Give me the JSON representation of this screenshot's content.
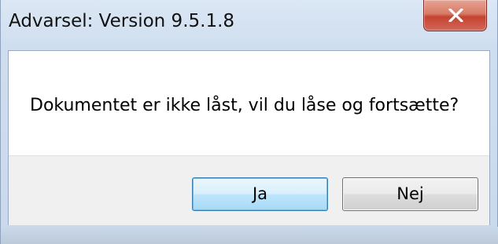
{
  "window": {
    "title": "Advarsel: Version 9.5.1.8",
    "close_icon": "close-icon"
  },
  "dialog": {
    "message": "Dokumentet er ikke låst, vil du låse og fortsætte?",
    "buttons": {
      "yes_label": "Ja",
      "no_label": "Nej"
    }
  },
  "colors": {
    "close_button": "#c5432f",
    "default_button_border": "#3c7fb1",
    "button_area_bg": "#f0f0f0",
    "frame": "#cfdeef"
  }
}
